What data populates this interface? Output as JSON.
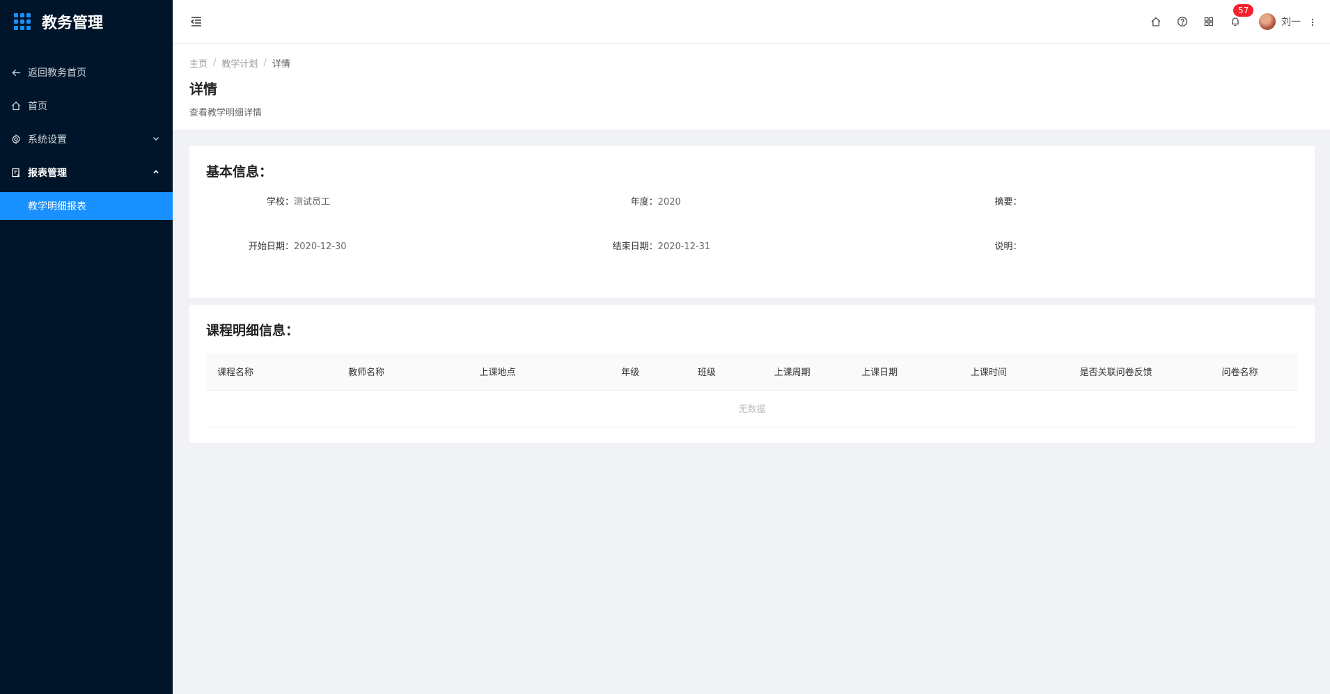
{
  "sidebar": {
    "title": "教务管理",
    "items": [
      {
        "label": "返回教务首页",
        "icon": "arrow-left-icon"
      },
      {
        "label": "首页",
        "icon": "home-icon"
      },
      {
        "label": "系统设置",
        "icon": "gear-icon"
      },
      {
        "label": "报表管理",
        "icon": "report-icon"
      }
    ],
    "submenu": [
      {
        "label": "教学明细报表"
      }
    ]
  },
  "header": {
    "notification_count": "57",
    "user_name": "刘一"
  },
  "breadcrumb": [
    "主页",
    "教学计划",
    "详情"
  ],
  "page": {
    "title": "详情",
    "description": "查看教学明细详情"
  },
  "basic_info": {
    "title": "基本信息：",
    "fields": [
      {
        "label": "学校：",
        "value": "测试员工"
      },
      {
        "label": "年度：",
        "value": "2020"
      },
      {
        "label": "摘要：",
        "value": ""
      },
      {
        "label": "开始日期：",
        "value": "2020-12-30"
      },
      {
        "label": "结束日期：",
        "value": "2020-12-31"
      },
      {
        "label": "说明：",
        "value": ""
      }
    ]
  },
  "course_info": {
    "title": "课程明细信息：",
    "columns": [
      "课程名称",
      "教师名称",
      "上课地点",
      "年级",
      "班级",
      "上课周期",
      "上课日期",
      "上课时间",
      "是否关联问卷反馈",
      "问卷名称"
    ],
    "empty_text": "无数据"
  },
  "colors": {
    "sidebar_bg": "#001529",
    "accent": "#1890ff",
    "badge": "#f5222d"
  }
}
